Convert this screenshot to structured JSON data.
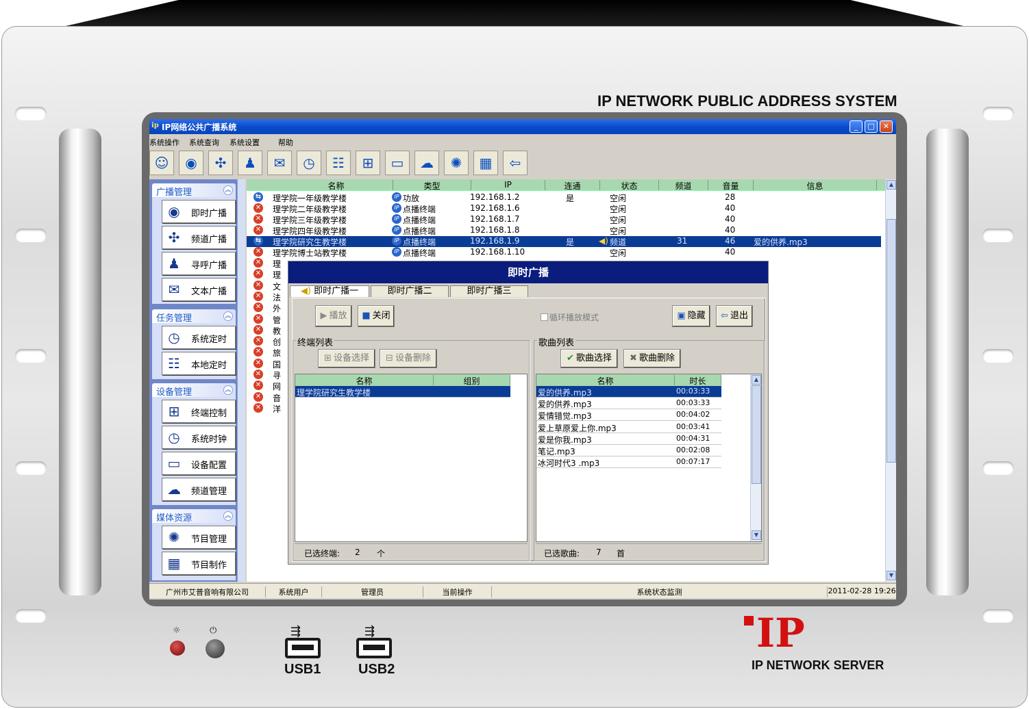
{
  "panel": {
    "brand_title": "IP NETWORK PUBLIC ADDRESS SYSTEM",
    "usb1": "USB1",
    "usb2": "USB2",
    "logo_text": "IP",
    "server_label": "IP NETWORK SERVER",
    "logo_color": "#d31010"
  },
  "window": {
    "title": "IP网络公共广播系统",
    "app_icon": "ip-logo-icon",
    "buttons": [
      "minimize",
      "maximize",
      "close"
    ]
  },
  "menu": [
    "系统操作",
    "系统查询",
    "系统设置",
    "帮助"
  ],
  "toolbar_icons": [
    "users-icon",
    "broadcast-icon",
    "channel-icon",
    "paging-icon",
    "text-broadcast-icon",
    "clock-icon",
    "schedule-icon",
    "terminal-icon",
    "device-config-icon",
    "channel-manage-icon",
    "program-icon",
    "video-icon",
    "exit-icon"
  ],
  "sidebar": {
    "groups": [
      {
        "title": "广播管理",
        "items": [
          "即时广播",
          "频道广播",
          "寻呼广播",
          "文本广播"
        ]
      },
      {
        "title": "任务管理",
        "items": [
          "系统定时",
          "本地定时"
        ]
      },
      {
        "title": "设备管理",
        "items": [
          "终端控制",
          "系统时钟",
          "设备配置",
          "频道管理"
        ]
      },
      {
        "title": "媒体资源",
        "items": [
          "节目管理",
          "节目制作"
        ]
      }
    ]
  },
  "grid": {
    "columns": [
      "名称",
      "类型",
      "IP",
      "连通",
      "状态",
      "频道",
      "音量",
      "信息"
    ],
    "rows": [
      {
        "name": "理学院一年级教学楼",
        "type": "功放",
        "ip": "192.168.1.2",
        "connected": "是",
        "status": "空闲",
        "channel": "",
        "volume": "28",
        "info": ""
      },
      {
        "name": "理学院二年级教学楼",
        "type": "点播终端",
        "ip": "192.168.1.6",
        "connected": "",
        "status": "空闲",
        "channel": "",
        "volume": "40",
        "info": ""
      },
      {
        "name": "理学院三年级教学楼",
        "type": "点播终端",
        "ip": "192.168.1.7",
        "connected": "",
        "status": "空闲",
        "channel": "",
        "volume": "40",
        "info": ""
      },
      {
        "name": "理学院四年级教学楼",
        "type": "点播终端",
        "ip": "192.168.1.8",
        "connected": "",
        "status": "空闲",
        "channel": "",
        "volume": "40",
        "info": ""
      },
      {
        "name": "理学院研究生教学楼",
        "type": "点播终端",
        "ip": "192.168.1.9",
        "connected": "是",
        "status": "频道",
        "channel": "31",
        "volume": "46",
        "info": "爱的供养.mp3"
      },
      {
        "name": "理学院博士站教学楼",
        "type": "点播终端",
        "ip": "192.168.1.10",
        "connected": "",
        "status": "空闲",
        "channel": "",
        "volume": "40",
        "info": ""
      }
    ],
    "partial_rows": [
      "理",
      "理",
      "文",
      "法",
      "外",
      "管",
      "教",
      "创",
      "旅",
      "国",
      "寻",
      "网",
      "音",
      "洋"
    ]
  },
  "statusbar": [
    "广州市艾普音响有限公司",
    "系统用户",
    "管理员",
    "当前操作",
    "系统状态监测",
    "2011-02-28 19:26"
  ],
  "dialog": {
    "title": "即时广播",
    "tabs": [
      "即时广播一",
      "即时广播二",
      "即时广播三"
    ],
    "play": "播放",
    "stop": "关闭",
    "loop": "循环播放模式",
    "hide": "隐藏",
    "exit": "退出",
    "terminal_group": "终端列表",
    "device_select": "设备选择",
    "device_delete": "设备删除",
    "terminal_columns": [
      "名称",
      "组别"
    ],
    "terminals": [
      {
        "name": "理学院研究生教学楼",
        "group": ""
      }
    ],
    "terminal_footer_label": "已选终端:",
    "terminal_count": "2",
    "terminal_unit": "个",
    "song_group": "歌曲列表",
    "song_select": "歌曲选择",
    "song_delete": "歌曲删除",
    "song_columns": [
      "名称",
      "时长"
    ],
    "songs": [
      {
        "name": "爱的供养.mp3",
        "duration": "00:03:33"
      },
      {
        "name": "爱的供养.mp3",
        "duration": "00:03:33"
      },
      {
        "name": "爱情错觉.mp3",
        "duration": "00:04:02"
      },
      {
        "name": "爱上草原爱上你.mp3",
        "duration": "00:03:41"
      },
      {
        "name": "爱是你我.mp3",
        "duration": "00:04:31"
      },
      {
        "name": "笔记.mp3",
        "duration": "00:02:08"
      },
      {
        "name": "冰河时代3 .mp3",
        "duration": "00:07:17"
      }
    ],
    "song_footer_label": "已选歌曲:",
    "song_count": "7",
    "song_unit": "首"
  }
}
